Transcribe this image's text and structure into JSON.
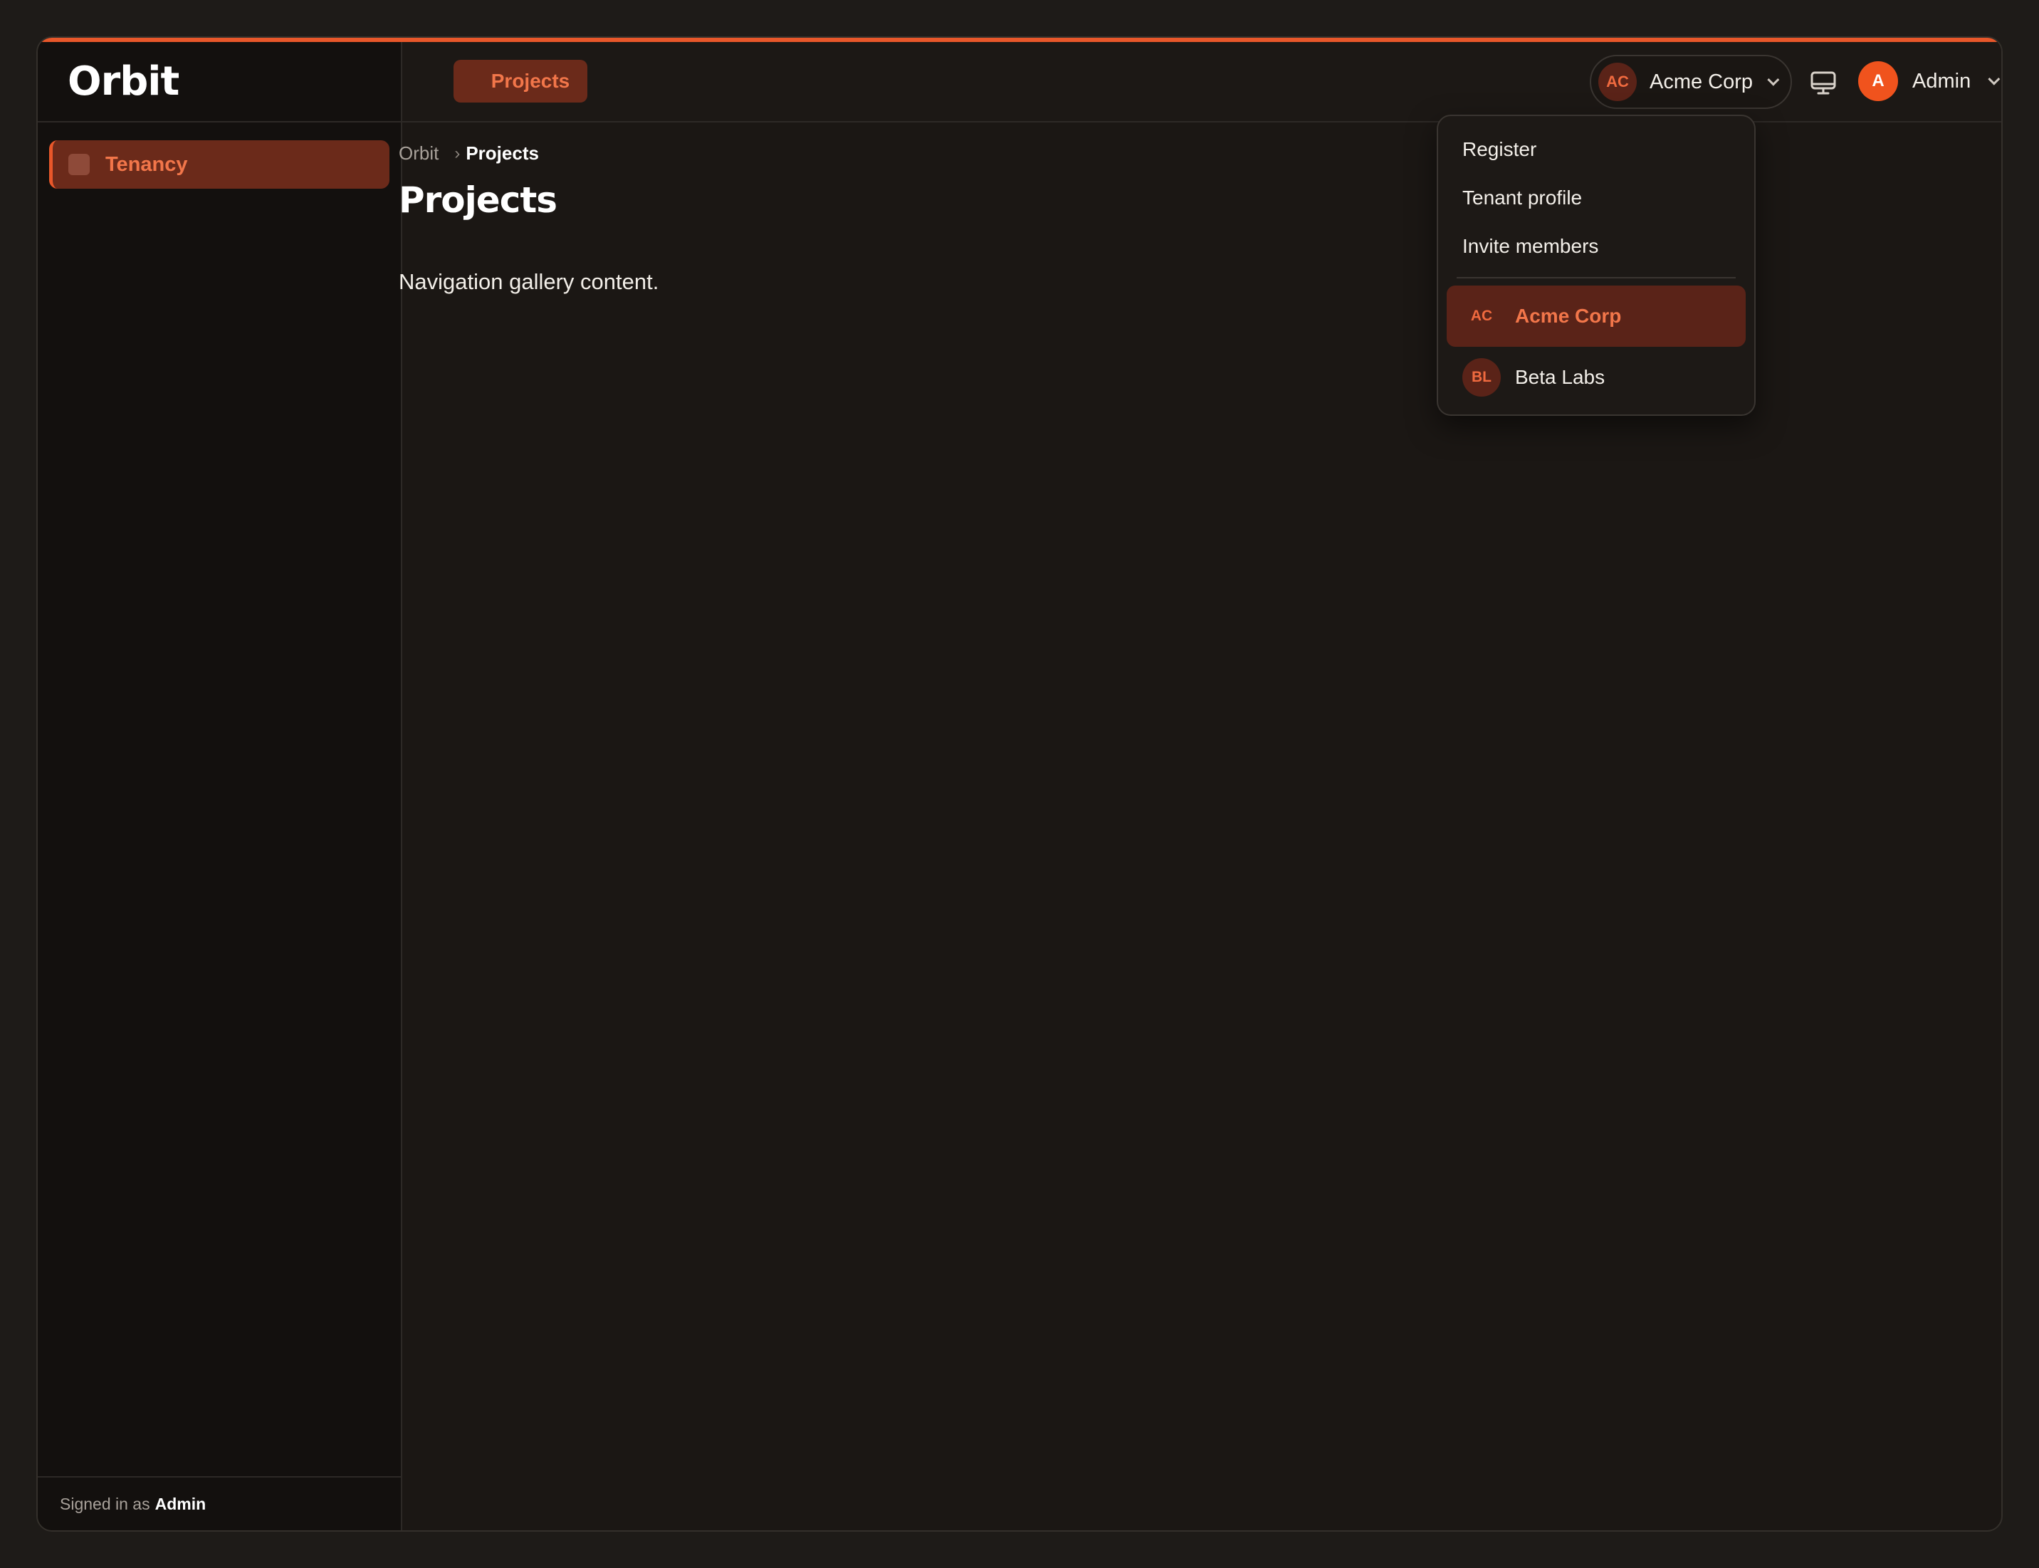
{
  "app": {
    "brand": "Orbit"
  },
  "sidebar": {
    "items": [
      {
        "label": "Tenancy"
      }
    ],
    "footer": {
      "prefix": "Signed in as",
      "user": "Admin"
    }
  },
  "topbar": {
    "tab": {
      "label": "Projects"
    },
    "tenant_switcher": {
      "initials": "AC",
      "name": "Acme Corp"
    },
    "user_menu": {
      "initial": "A",
      "name": "Admin"
    }
  },
  "breadcrumb": {
    "root": "Orbit",
    "current": "Projects"
  },
  "page": {
    "title": "Projects",
    "body": "Navigation gallery content."
  },
  "dropdown": {
    "actions": [
      {
        "label": "Register"
      },
      {
        "label": "Tenant profile"
      },
      {
        "label": "Invite members"
      }
    ],
    "tenants": [
      {
        "initials": "AC",
        "name": "Acme Corp",
        "active": true
      },
      {
        "initials": "BL",
        "name": "Beta Labs",
        "active": false
      }
    ]
  },
  "colors": {
    "accent": "#e8572a",
    "background": "#1b1714",
    "sidebar": "#13100e",
    "active_bg": "#6b2a1a"
  }
}
